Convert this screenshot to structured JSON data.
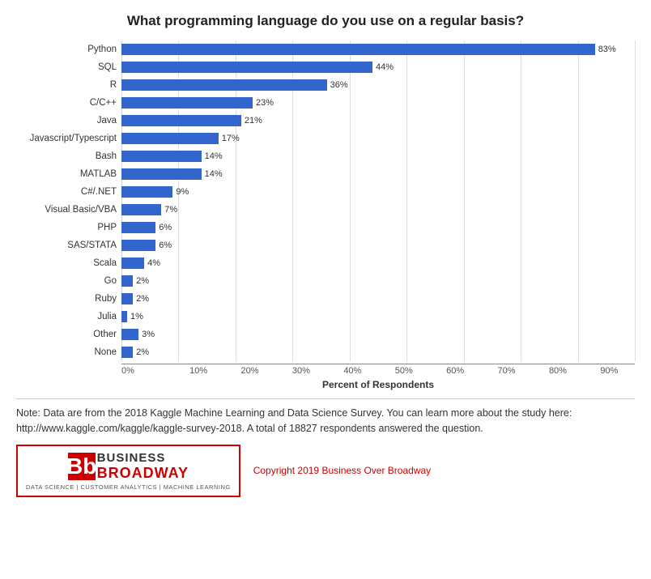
{
  "title": "What programming language do you use on a regular basis?",
  "bars": [
    {
      "label": "Python",
      "value": 83,
      "display": "83%"
    },
    {
      "label": "SQL",
      "value": 44,
      "display": "44%"
    },
    {
      "label": "R",
      "value": 36,
      "display": "36%"
    },
    {
      "label": "C/C++",
      "value": 23,
      "display": "23%"
    },
    {
      "label": "Java",
      "value": 21,
      "display": "21%"
    },
    {
      "label": "Javascript/Typescript",
      "value": 17,
      "display": "17%"
    },
    {
      "label": "Bash",
      "value": 14,
      "display": "14%"
    },
    {
      "label": "MATLAB",
      "value": 14,
      "display": "14%"
    },
    {
      "label": "C#/.NET",
      "value": 9,
      "display": "9%"
    },
    {
      "label": "Visual Basic/VBA",
      "value": 7,
      "display": "7%"
    },
    {
      "label": "PHP",
      "value": 6,
      "display": "6%"
    },
    {
      "label": "SAS/STATA",
      "value": 6,
      "display": "6%"
    },
    {
      "label": "Scala",
      "value": 4,
      "display": "4%"
    },
    {
      "label": "Go",
      "value": 2,
      "display": "2%"
    },
    {
      "label": "Ruby",
      "value": 2,
      "display": "2%"
    },
    {
      "label": "Julia",
      "value": 1,
      "display": "1%"
    },
    {
      "label": "Other",
      "value": 3,
      "display": "3%"
    },
    {
      "label": "None",
      "value": 2,
      "display": "2%"
    }
  ],
  "x_ticks": [
    "0%",
    "10%",
    "20%",
    "30%",
    "40%",
    "50%",
    "60%",
    "70%",
    "80%",
    "90%"
  ],
  "x_max": 90,
  "x_axis_label": "Percent of Respondents",
  "note": "Note: Data are from the 2018 Kaggle Machine Learning and Data Science Survey. You can learn more about the study here: http://www.kaggle.com/kaggle/kaggle-survey-2018.  A total of 18827 respondents answered the question.",
  "logo": {
    "b1": "B",
    "b2": "b",
    "business": "BUSINESS",
    "broadway": "BROADWAY",
    "tagline": "DATA SCIENCE | CUSTOMER ANALYTICS | MACHINE LEARNING",
    "copyright": "Copyright 2019 Business Over Broadway"
  }
}
